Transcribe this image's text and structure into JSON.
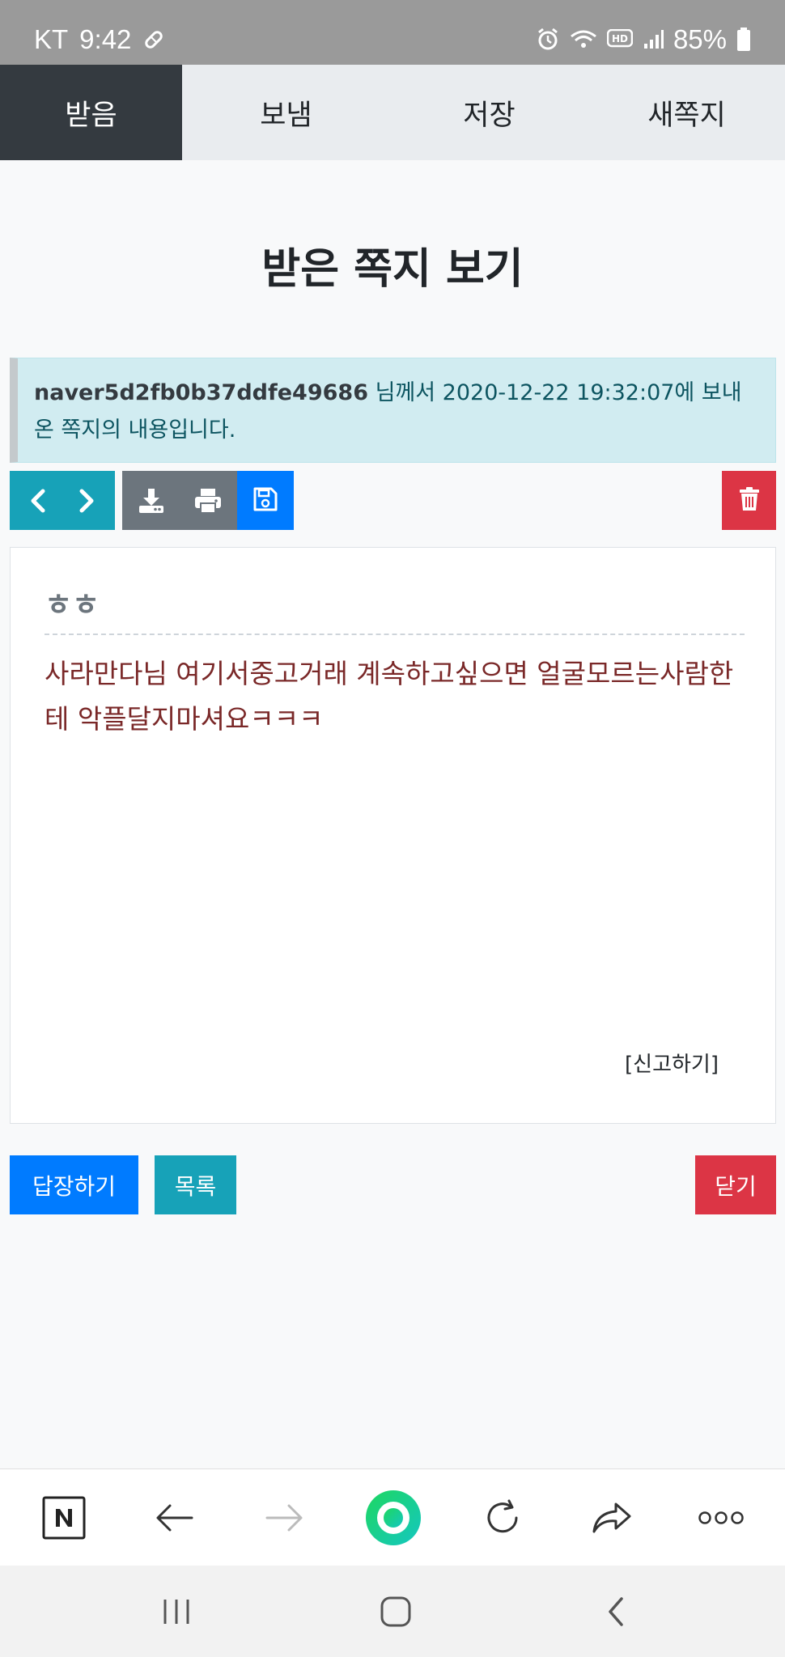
{
  "status_bar": {
    "carrier": "KT",
    "time": "9:42",
    "battery": "85%",
    "icons": [
      "pill-icon",
      "alarm-icon",
      "wifi-icon",
      "hd-icon",
      "signal-icon",
      "battery-icon"
    ]
  },
  "tabs": [
    {
      "label": "받음",
      "active": true
    },
    {
      "label": "보냄",
      "active": false
    },
    {
      "label": "저장",
      "active": false
    },
    {
      "label": "새쪽지",
      "active": false
    }
  ],
  "page_title": "받은 쪽지 보기",
  "info": {
    "sender": "naver5d2fb0b37ddfe49686",
    "text": " 님께서 2020-12-22 19:32:07에 보내온 쪽지의 내용입니다."
  },
  "toolbar": {
    "icons": [
      "chevron-left-icon",
      "chevron-right-icon",
      "download-icon",
      "print-icon",
      "save-icon",
      "trash-icon"
    ]
  },
  "message": {
    "subject": "ㅎㅎ",
    "body": "사라만다님 여기서중고거래 계속하고싶으면 얼굴모르는사람한테 악플달지마셔요ㅋㅋㅋ",
    "report_label": "[신고하기]"
  },
  "actions": {
    "reply_label": "답장하기",
    "list_label": "목록",
    "close_label": "닫기"
  },
  "colors": {
    "active_tab": "#343a40",
    "teal": "#17a2b8",
    "gray": "#6c757d",
    "blue": "#007bff",
    "red": "#dc3545",
    "info_bg": "#d1ecf1"
  },
  "browser_bar": {
    "icons": [
      "naver-icon",
      "back-arrow-icon",
      "forward-arrow-icon",
      "green-dot-icon",
      "refresh-icon",
      "share-icon",
      "more-icon"
    ]
  },
  "system_nav": {
    "icons": [
      "recent-apps-icon",
      "home-icon",
      "back-icon"
    ]
  }
}
